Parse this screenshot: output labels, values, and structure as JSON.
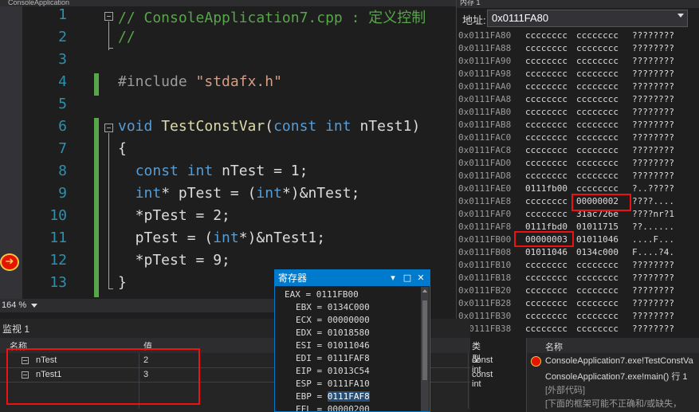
{
  "editor": {
    "tab_label": "ConsoleApplication",
    "lines": [
      {
        "num": "1",
        "parts": [
          [
            "cm",
            "// ConsoleApplication7.cpp : 定义控制"
          ]
        ]
      },
      {
        "num": "2",
        "parts": [
          [
            "cm",
            "//"
          ]
        ]
      },
      {
        "num": "3",
        "parts": []
      },
      {
        "num": "4",
        "parts": [
          [
            "pp",
            "#include "
          ],
          [
            "str",
            "\"stdafx.h\""
          ]
        ]
      },
      {
        "num": "5",
        "parts": []
      },
      {
        "num": "6",
        "parts": [
          [
            "kw",
            "void "
          ],
          [
            "fn",
            "TestConstVar"
          ],
          [
            "tx",
            "("
          ],
          [
            "kw",
            "const int "
          ],
          [
            "tx",
            "nTest1)"
          ]
        ]
      },
      {
        "num": "7",
        "parts": [
          [
            "tx",
            "{"
          ]
        ]
      },
      {
        "num": "8",
        "parts": [
          [
            "tx",
            "  "
          ],
          [
            "kw",
            "const int "
          ],
          [
            "tx",
            "nTest = 1;"
          ]
        ]
      },
      {
        "num": "9",
        "parts": [
          [
            "tx",
            "  "
          ],
          [
            "kw",
            "int"
          ],
          [
            "tx",
            "* pTest = ("
          ],
          [
            "kw",
            "int"
          ],
          [
            "tx",
            "*)&nTest;"
          ]
        ]
      },
      {
        "num": "10",
        "parts": [
          [
            "tx",
            "  *pTest = 2;"
          ]
        ]
      },
      {
        "num": "11",
        "parts": [
          [
            "tx",
            "  pTest = ("
          ],
          [
            "kw",
            "int"
          ],
          [
            "tx",
            "*)&nTest1;"
          ]
        ]
      },
      {
        "num": "12",
        "parts": [
          [
            "tx",
            "  *pTest = 9;"
          ]
        ]
      },
      {
        "num": "13",
        "parts": [
          [
            "tx",
            "}"
          ]
        ]
      }
    ]
  },
  "zoom": {
    "level": "164 %"
  },
  "memory": {
    "title": "内存 1",
    "address_label": "地址:",
    "address_value": "0x0111FA80",
    "rows": [
      [
        "0x0111FA80",
        "cccccccc",
        "cccccccc",
        "????????"
      ],
      [
        "0x0111FA88",
        "cccccccc",
        "cccccccc",
        "????????"
      ],
      [
        "0x0111FA90",
        "cccccccc",
        "cccccccc",
        "????????"
      ],
      [
        "0x0111FA98",
        "cccccccc",
        "cccccccc",
        "????????"
      ],
      [
        "0x0111FAA0",
        "cccccccc",
        "cccccccc",
        "????????"
      ],
      [
        "0x0111FAA8",
        "cccccccc",
        "cccccccc",
        "????????"
      ],
      [
        "0x0111FAB0",
        "cccccccc",
        "cccccccc",
        "????????"
      ],
      [
        "0x0111FAB8",
        "cccccccc",
        "cccccccc",
        "????????"
      ],
      [
        "0x0111FAC0",
        "cccccccc",
        "cccccccc",
        "????????"
      ],
      [
        "0x0111FAC8",
        "cccccccc",
        "cccccccc",
        "????????"
      ],
      [
        "0x0111FAD0",
        "cccccccc",
        "cccccccc",
        "????????"
      ],
      [
        "0x0111FAD8",
        "cccccccc",
        "cccccccc",
        "????????"
      ],
      [
        "0x0111FAE0",
        "0111fb00",
        "cccccccc",
        "?..?????"
      ],
      [
        "0x0111FAE8",
        "cccccccc",
        "00000002",
        "????...."
      ],
      [
        "0x0111FAF0",
        "cccccccc",
        "31ac726e",
        "????nr?1"
      ],
      [
        "0x0111FAF8",
        "0111fbd0",
        "01011715",
        "??......"
      ],
      [
        "0x0111FB00",
        "00000003",
        "01011046",
        "....F..."
      ],
      [
        "0x0111FB08",
        "01011046",
        "0134c000",
        "F....?4."
      ],
      [
        "0x0111FB10",
        "cccccccc",
        "cccccccc",
        "????????"
      ],
      [
        "0x0111FB18",
        "cccccccc",
        "cccccccc",
        "????????"
      ],
      [
        "0x0111FB20",
        "cccccccc",
        "cccccccc",
        "????????"
      ],
      [
        "0x0111FB28",
        "cccccccc",
        "cccccccc",
        "????????"
      ],
      [
        "0x0111FB30",
        "cccccccc",
        "cccccccc",
        "????????"
      ],
      [
        "0x0111FB38",
        "cccccccc",
        "cccccccc",
        "????????"
      ]
    ]
  },
  "registers": {
    "title": "寄存器",
    "items": [
      {
        "name": "EAX",
        "value": "0111FB00",
        "highlight": false
      },
      {
        "name": "EBX",
        "value": "0134C000",
        "highlight": false
      },
      {
        "name": "ECX",
        "value": "00000000",
        "highlight": false
      },
      {
        "name": "EDX",
        "value": "01018580",
        "highlight": false
      },
      {
        "name": "ESI",
        "value": "01011046",
        "highlight": false
      },
      {
        "name": "EDI",
        "value": "0111FAF8",
        "highlight": false
      },
      {
        "name": "EIP",
        "value": "01013C54",
        "highlight": false
      },
      {
        "name": "ESP",
        "value": "0111FA10",
        "highlight": false
      },
      {
        "name": "EBP",
        "value": "0111FAF8",
        "highlight": true
      },
      {
        "name": "EFL",
        "value": "00000200",
        "highlight": false
      }
    ]
  },
  "watch": {
    "title": "监视 1",
    "col_name": "名称",
    "col_value": "值",
    "col_type": "类型",
    "rows": [
      {
        "name": "nTest",
        "value": "2",
        "type": "const int"
      },
      {
        "name": "nTest1",
        "value": "3",
        "type": "const int"
      }
    ]
  },
  "callstack": {
    "col_name": "名称",
    "rows": [
      "ConsoleApplication7.exe!TestConstVa",
      "ConsoleApplication7.exe!main() 行 1",
      "[外部代码]",
      "[下面的框架可能不正确和/或缺失，"
    ]
  },
  "colors": {
    "highlight_box": "#ee1111",
    "accent": "#007acc",
    "keyword": "#569cd6",
    "comment": "#57a64a",
    "line_number": "#2b91af"
  }
}
